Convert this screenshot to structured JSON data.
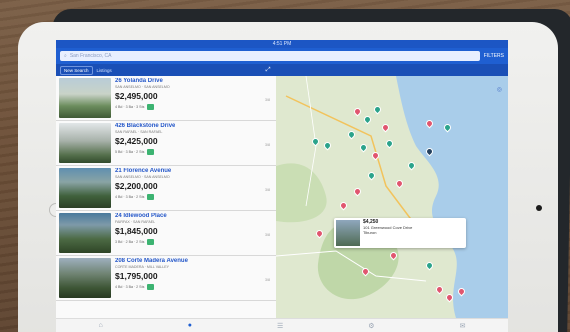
{
  "status_bar": {
    "time": "4:51 PM"
  },
  "search": {
    "placeholder": "San Francisco, CA"
  },
  "filter_label": "FILTERS",
  "sub_bar": {
    "button": "New Search",
    "label": "Listings"
  },
  "listings": [
    {
      "address": "26 Yolanda Drive",
      "city": "SAN ANSELMO · SAN ANSELMO",
      "price": "$2,495,000",
      "specs": "4 Bd · 3 Ba · 3 Sts",
      "end": "3/8"
    },
    {
      "address": "426 Blackstone Drive",
      "city": "SAN RAFAEL · SAN RAFAEL",
      "price": "$2,425,000",
      "specs": "5 Bd · 3 Ba · 2 Sts",
      "end": "3/8"
    },
    {
      "address": "21 Florence Avenue",
      "city": "SAN ANSELMO · SAN ANSELMO",
      "price": "$2,200,000",
      "specs": "4 Bd · 3 Ba · 2 Sts",
      "end": "3/8"
    },
    {
      "address": "24 Idlewood Place",
      "city": "FAIRFAX · SAN RAFAEL",
      "price": "$1,845,000",
      "specs": "3 Bd · 2 Ba · 2 Sts",
      "end": "3/8"
    },
    {
      "address": "208 Corte Madera Avenue",
      "city": "CORTE MADERA · MILL VALLEY",
      "price": "$1,795,000",
      "specs": "4 Bd · 3 Ba · 2 Sts",
      "end": "3/8"
    }
  ],
  "map_popup": {
    "price": "$4,250",
    "line1": "101 Greenwood Cove Drive",
    "line2": "Tiburon"
  },
  "tabs": [
    "⌂",
    "●",
    "☰",
    "⚙",
    "✉"
  ],
  "colors": {
    "brand_blue": "#1f5fd1",
    "accent_green": "#3cb371",
    "pin_red": "#e0566f",
    "pin_teal": "#2ba38b"
  }
}
